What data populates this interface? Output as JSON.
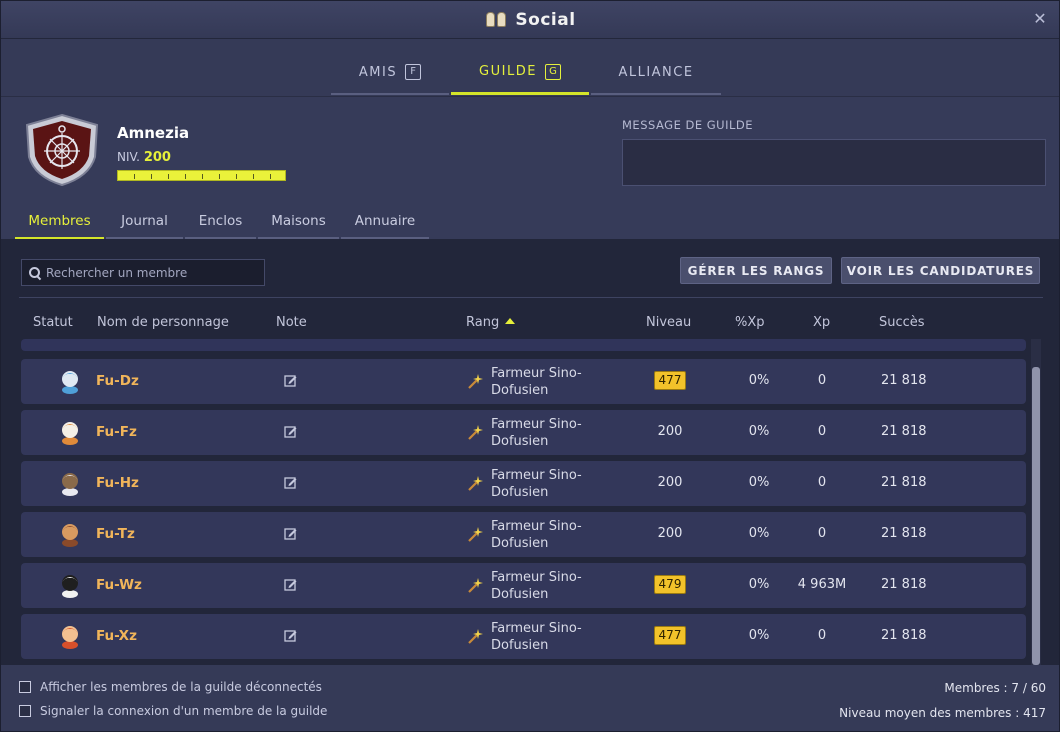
{
  "window": {
    "title": "Social",
    "close_label": "✕"
  },
  "main_tabs": [
    {
      "label": "AMIS",
      "key": "F"
    },
    {
      "label": "GUILDE",
      "key": "G"
    },
    {
      "label": "ALLIANCE"
    }
  ],
  "guild": {
    "name": "Amnezia",
    "level_label": "NIV.",
    "level": "200",
    "xp_progress": 1.0,
    "message_label": "MESSAGE DE GUILDE",
    "message": ""
  },
  "sub_tabs": [
    "Membres",
    "Journal",
    "Enclos",
    "Maisons",
    "Annuaire"
  ],
  "toolbar": {
    "search_placeholder": "Rechercher un membre",
    "manage_ranks": "GÉRER LES RANGS",
    "view_applications": "VOIR LES CANDIDATURES"
  },
  "columns": {
    "status": "Statut",
    "name": "Nom de personnage",
    "note": "Note",
    "rank": "Rang",
    "level": "Niveau",
    "xp_pct": "%Xp",
    "xp": "Xp",
    "success": "Succès"
  },
  "members": [
    {
      "name": "Fu-Dz",
      "rank": "Farmeur Sino-Dofusien",
      "level": "477",
      "omega": true,
      "xp_pct": "0%",
      "xp": "0",
      "success": "21 818",
      "avatar": "eniripsa-blue"
    },
    {
      "name": "Fu-Fz",
      "rank": "Farmeur Sino-Dofusien",
      "level": "200",
      "omega": false,
      "xp_pct": "0%",
      "xp": "0",
      "success": "21 818",
      "avatar": "ecaflip-orange"
    },
    {
      "name": "Fu-Hz",
      "rank": "Farmeur Sino-Dofusien",
      "level": "200",
      "omega": false,
      "xp_pct": "0%",
      "xp": "0",
      "success": "21 818",
      "avatar": "sadida-white"
    },
    {
      "name": "Fu-Tz",
      "rank": "Farmeur Sino-Dofusien",
      "level": "200",
      "omega": false,
      "xp_pct": "0%",
      "xp": "0",
      "success": "21 818",
      "avatar": "osamodas-brown"
    },
    {
      "name": "Fu-Wz",
      "rank": "Farmeur Sino-Dofusien",
      "level": "479",
      "omega": true,
      "xp_pct": "0%",
      "xp": "4 963M",
      "success": "21 818",
      "avatar": "sram-panda"
    },
    {
      "name": "Fu-Xz",
      "rank": "Farmeur Sino-Dofusien",
      "level": "477",
      "omega": true,
      "xp_pct": "0%",
      "xp": "0",
      "success": "21 818",
      "avatar": "iop-red"
    }
  ],
  "footer": {
    "show_offline": "Afficher les membres de la guilde déconnectés",
    "notify_login": "Signaler la connexion d'un membre de la guilde",
    "members_count": "Membres : 7 / 60",
    "avg_level": "Niveau moyen des membres : 417"
  },
  "colors": {
    "accent": "#e6f03a",
    "name": "#f1b55a",
    "omega_badge": "#f2c22a"
  }
}
